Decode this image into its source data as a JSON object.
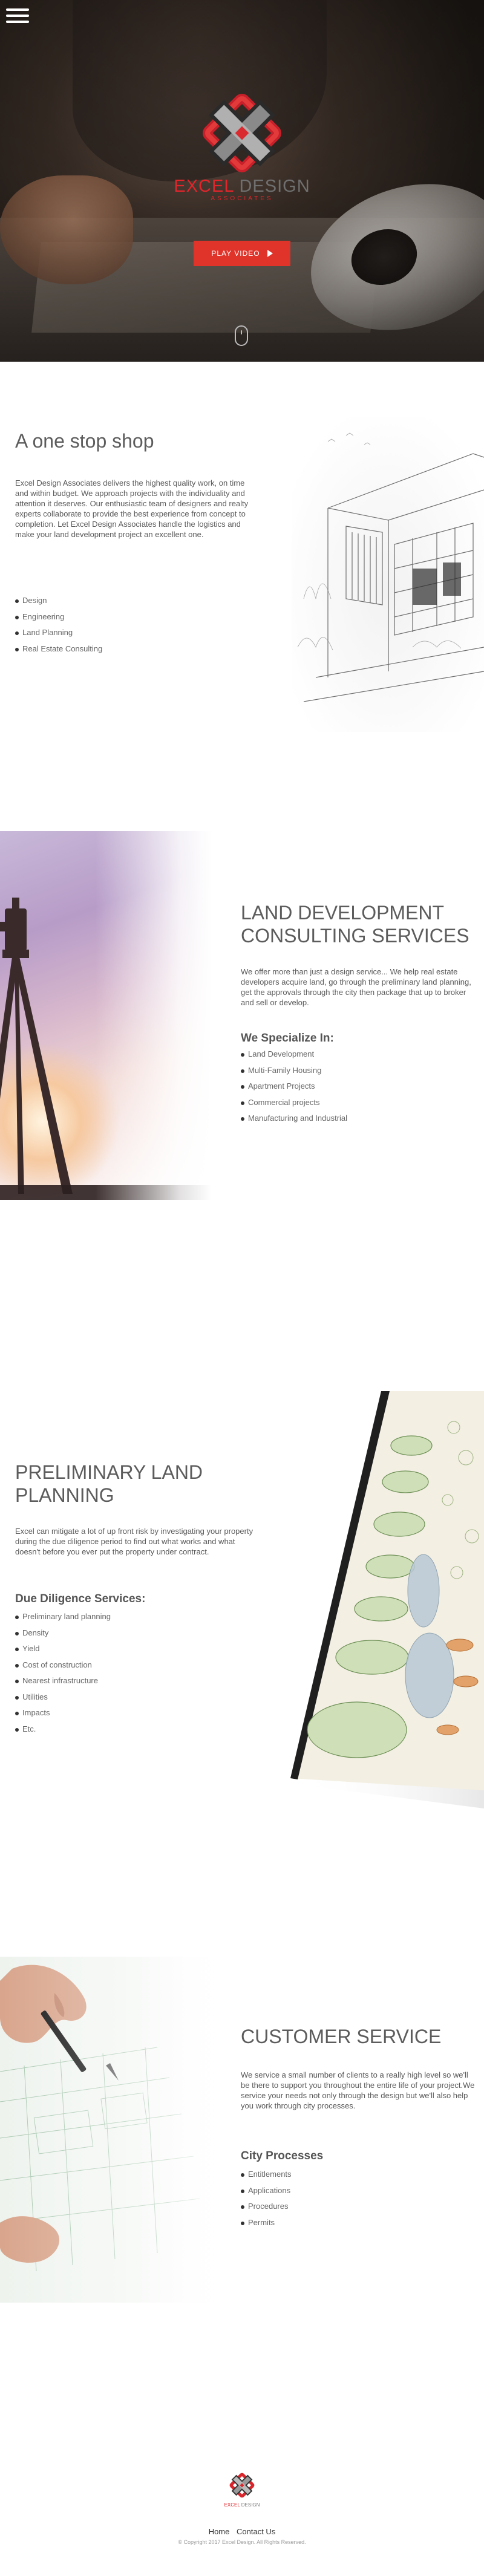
{
  "header": {
    "menu_icon": "hamburger-menu-icon",
    "logo_word1": "EXCEL",
    "logo_word2": "DESIGN",
    "logo_sub": "ASSOCIATES",
    "play_label": "PLAY VIDEO",
    "play_icon": "play-icon",
    "scroll_icon": "mouse-scroll-icon",
    "brand_red": "#e0252b"
  },
  "sections": {
    "one_stop": {
      "title": "A one stop shop",
      "text": "Excel Design Associates delivers the highest quality work, on time and within budget. We approach projects with the individuality and attention it deserves. Our enthusiastic team of designers and realty experts collaborate to provide the best experience from concept to completion. Let Excel Design Associates handle the logistics and make your land development project an excellent one.",
      "items": [
        "Design",
        "Engineering",
        "Land Planning",
        "Real Estate Consulting"
      ]
    },
    "land_dev": {
      "title": "LAND DEVELOPMENT CONSULTING SERVICES",
      "text": "We offer more than just a design service... We help real estate developers acquire land, go through the preliminary land planning, get the approvals through the city then package that up to broker and sell or develop.",
      "subtitle": "We Specialize In:",
      "items": [
        "Land Development",
        "Multi-Family Housing",
        "Apartment Projects",
        "Commercial projects",
        "Manufacturing and Industrial"
      ]
    },
    "prelim": {
      "title": "PRELIMINARY LAND PLANNING",
      "text": "Excel can mitigate a lot of up front risk by investigating your property during the due diligence period to find out what works and what doesn't before you ever put the property under contract.",
      "subtitle": "Due Diligence Services:",
      "items": [
        "Preliminary land planning",
        "Density",
        "Yield",
        "Cost of construction",
        "Nearest infrastructure",
        "Utilities",
        "Impacts",
        "Etc."
      ]
    },
    "customer": {
      "title": "CUSTOMER SERVICE",
      "text": "We service a small number of clients to a really high level so we'll be there to support you throughout the entire life of your project.We service your needs not only through the design but we'll also help you work through city processes.",
      "subtitle": "City Processes",
      "items": [
        "Entitlements",
        "Applications",
        "Procedures",
        "Permits"
      ]
    }
  },
  "footer": {
    "logo_word1": "EXCEL",
    "logo_word2": "DESIGN",
    "nav": [
      "Home",
      "Contact Us"
    ],
    "copyright": "© Copyright 2017 Excel Design. All Rights Reserved."
  }
}
